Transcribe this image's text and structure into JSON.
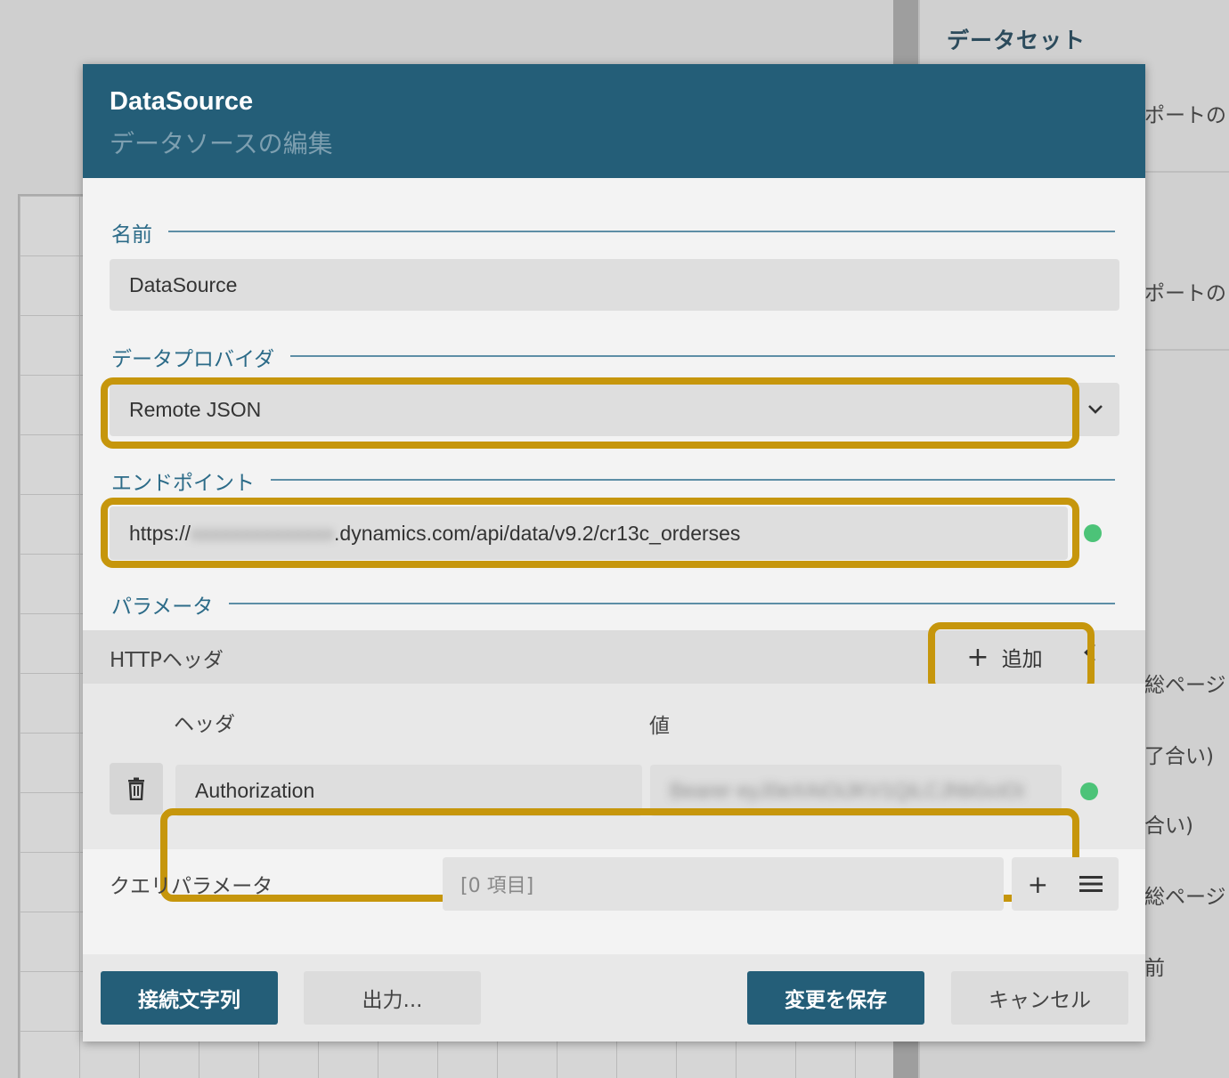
{
  "background": {
    "panel_title": "データセット",
    "panel_texts": [
      "ポートの",
      "ポートの",
      "総ページ",
      "了合い)",
      "合い)",
      "総ページ",
      "前"
    ]
  },
  "modal": {
    "title": "DataSource",
    "subtitle": "データソースの編集",
    "name_section": {
      "label": "名前",
      "value": "DataSource"
    },
    "provider_section": {
      "label": "データプロバイダ",
      "value": "Remote JSON"
    },
    "endpoint_section": {
      "label": "エンドポイント",
      "value_prefix": "https://",
      "value_redacted": "xxxxxxxxxxxxxx",
      "value_suffix": ".dynamics.com/api/data/v9.2/cr13c_orderses"
    },
    "parameters_section": {
      "label": "パラメータ",
      "http_headers": {
        "label": "HTTPヘッダ",
        "add_label": "追加",
        "col_header": "ヘッダ",
        "col_value": "値",
        "rows": [
          {
            "header": "Authorization",
            "value": "Bearer eyJ0eXAiOiJKV1QiLCJhbGciOi"
          }
        ]
      },
      "query_params": {
        "label": "クエリパラメータ",
        "value": "[0 項目]"
      }
    },
    "footer": {
      "connection_string": "接続文字列",
      "export": "出力...",
      "save": "変更を保存",
      "cancel": "キャンセル"
    }
  },
  "colors": {
    "header": "#245e78",
    "highlight": "#c6960c",
    "status_ok": "#4cc378"
  }
}
